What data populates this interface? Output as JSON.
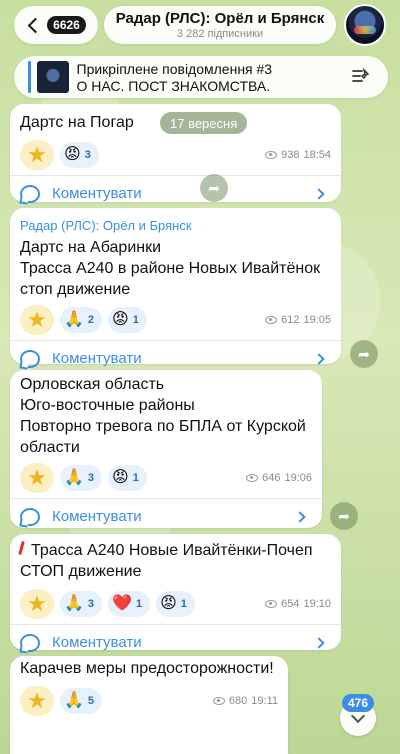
{
  "header": {
    "back_count": "6626",
    "title": "Радар (РЛС): Орёл и Брянск",
    "subtitle": "3 282 підписники"
  },
  "pinned": {
    "heading": "Прикріплене повідомлення #3",
    "body": "О НАС. ПОСТ ЗНАКОМСТВА."
  },
  "date_separator": "17 вересня",
  "messages": [
    {
      "text": "Дартс на Погар",
      "reactions": [
        {
          "emoji": "😡",
          "count": "3"
        }
      ],
      "views": "938",
      "time": "18:54",
      "comment_label": "Коментувати"
    },
    {
      "channel": "Радар (РЛС): Орёл и Брянск",
      "lines": [
        "Дартс на Абаринки",
        "Трасса А240 в районе  Новых Ивайтёнок",
        "стоп движение"
      ],
      "reactions": [
        {
          "emoji": "🙏",
          "count": "2"
        },
        {
          "emoji": "😡",
          "count": "1"
        }
      ],
      "views": "612",
      "time": "19:05",
      "comment_label": "Коментувати"
    },
    {
      "lines": [
        "Орловская область",
        "Юго-восточные районы",
        "Повторно тревога по БПЛА от Курской",
        "области"
      ],
      "reactions": [
        {
          "emoji": "🙏",
          "count": "3"
        },
        {
          "emoji": "😡",
          "count": "1"
        }
      ],
      "views": "646",
      "time": "19:06",
      "comment_label": "Коментувати"
    },
    {
      "lines": [
        "Трасса А240 Новые Ивайтёнки-Почеп",
        "СТОП движение"
      ],
      "reactions": [
        {
          "emoji": "🙏",
          "count": "3"
        },
        {
          "emoji": "❤️",
          "count": "1"
        },
        {
          "emoji": "😡",
          "count": "1"
        }
      ],
      "views": "654",
      "time": "19:10",
      "comment_label": "Коментувати"
    },
    {
      "text": "Карачев меры предосторожности!",
      "reactions": [
        {
          "emoji": "🙏",
          "count": "5"
        }
      ],
      "views": "680",
      "time": "19:11"
    }
  ],
  "unread_count": "476"
}
